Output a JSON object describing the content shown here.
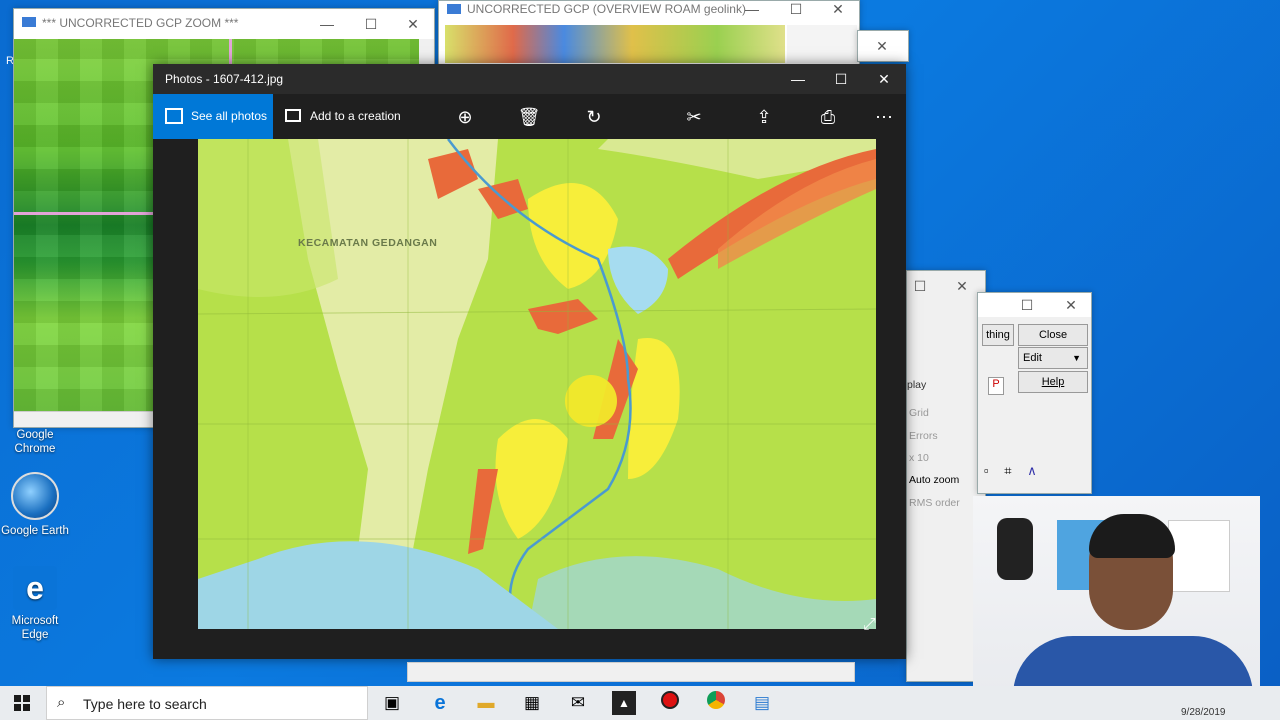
{
  "desktop_icons": [
    {
      "label": "Google Chrome",
      "icon": "chrome-icon"
    },
    {
      "label": "Google Earth",
      "icon": "google-earth-icon"
    },
    {
      "label": "Microsoft Edge",
      "icon": "edge-icon"
    }
  ],
  "zoom_window": {
    "title": "*** UNCORRECTED GCP ZOOM ***"
  },
  "overview_window": {
    "title": "UNCORRECTED GCP (OVERVIEW ROAM geolink)"
  },
  "photos": {
    "title": "Photos - 1607-412.jpg",
    "see_all": "See all photos",
    "add_creation": "Add to a creation",
    "map_label": "KECAMATAN GEDANGAN"
  },
  "side_dialog": {
    "close": "Close",
    "edit": "Edit",
    "help": "Help",
    "thing": "thing",
    "display_label": "play",
    "opts": [
      "Grid",
      "Errors",
      "x 10",
      "Auto zoom",
      "RMS order"
    ]
  },
  "taskbar": {
    "search_placeholder": "Type here to search",
    "date": "9/28/2019"
  },
  "colors": {
    "accent": "#0078d7",
    "desktop": "#0a6bd0",
    "map_green": "#b6e04a"
  }
}
